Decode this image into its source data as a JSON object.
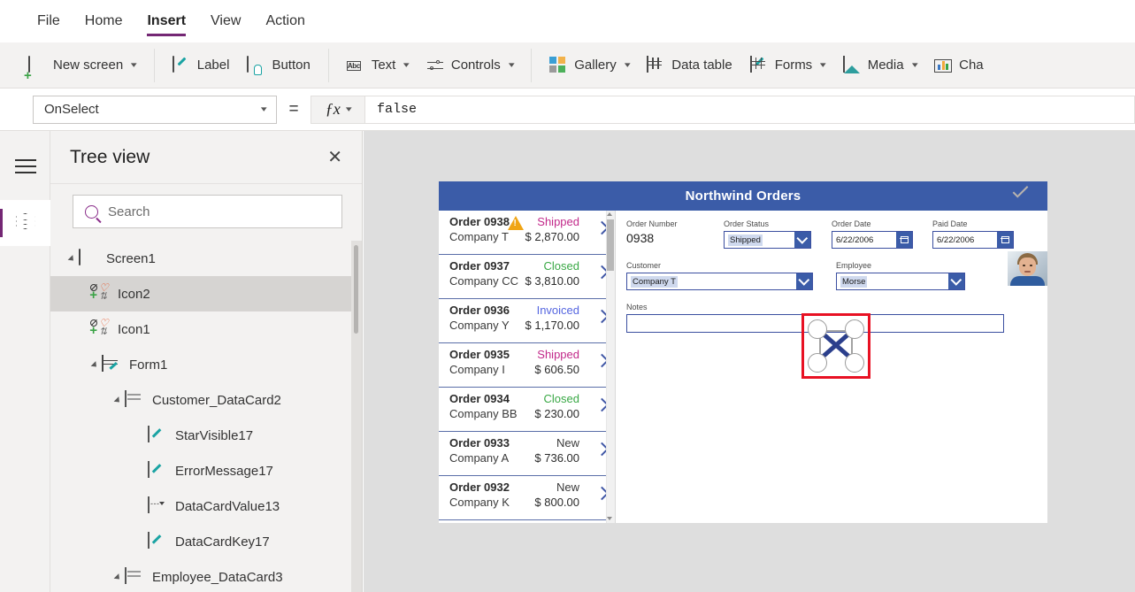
{
  "menubar": {
    "items": [
      {
        "label": "File",
        "active": false
      },
      {
        "label": "Home",
        "active": false
      },
      {
        "label": "Insert",
        "active": true
      },
      {
        "label": "View",
        "active": false
      },
      {
        "label": "Action",
        "active": false
      }
    ]
  },
  "ribbon": {
    "items": [
      {
        "label": "New screen",
        "icon": "new-screen-icon",
        "caret": true
      },
      {
        "label": "Label",
        "icon": "label-icon",
        "caret": false
      },
      {
        "label": "Button",
        "icon": "button-icon",
        "caret": false
      },
      {
        "label": "Text",
        "icon": "text-abc-icon",
        "caret": true
      },
      {
        "label": "Controls",
        "icon": "controls-icon",
        "caret": true
      },
      {
        "label": "Gallery",
        "icon": "gallery-icon",
        "caret": true
      },
      {
        "label": "Data table",
        "icon": "data-table-icon",
        "caret": false
      },
      {
        "label": "Forms",
        "icon": "forms-icon",
        "caret": true
      },
      {
        "label": "Media",
        "icon": "media-icon",
        "caret": true
      },
      {
        "label": "Cha",
        "icon": "charts-icon",
        "caret": false
      }
    ]
  },
  "formula_bar": {
    "property": "OnSelect",
    "equals": "=",
    "fx_label": "ƒx",
    "value": "false"
  },
  "tree_view": {
    "title": "Tree view",
    "close_label": "✕",
    "search_placeholder": "Search",
    "search_value": "",
    "nodes": [
      {
        "label": "Screen1",
        "indent": 0,
        "icon": "screen-icon",
        "expanded": true,
        "selected": false
      },
      {
        "label": "Icon2",
        "indent": 1,
        "icon": "icons-group-icon",
        "expanded": null,
        "selected": true
      },
      {
        "label": "Icon1",
        "indent": 1,
        "icon": "icons-group-icon",
        "expanded": null,
        "selected": false
      },
      {
        "label": "Form1",
        "indent": 1,
        "icon": "form-icon",
        "expanded": true,
        "selected": false
      },
      {
        "label": "Customer_DataCard2",
        "indent": 2,
        "icon": "datacard-icon",
        "expanded": true,
        "selected": false
      },
      {
        "label": "StarVisible17",
        "indent": 3,
        "icon": "label-pencil-icon",
        "expanded": null,
        "selected": false
      },
      {
        "label": "ErrorMessage17",
        "indent": 3,
        "icon": "label-pencil-icon",
        "expanded": null,
        "selected": false
      },
      {
        "label": "DataCardValue13",
        "indent": 3,
        "icon": "dropdown-value-icon",
        "expanded": null,
        "selected": false
      },
      {
        "label": "DataCardKey17",
        "indent": 3,
        "icon": "label-pencil-icon",
        "expanded": null,
        "selected": false
      },
      {
        "label": "Employee_DataCard3",
        "indent": 2,
        "icon": "datacard-icon",
        "expanded": true,
        "selected": false
      }
    ]
  },
  "canvas": {
    "app": {
      "header_title": "Northwind Orders",
      "header_color": "#3b5ca8",
      "confirm_icon": "checkmark-icon",
      "gallery": [
        {
          "order": "Order 0938",
          "company": "Company T",
          "status": "Shipped",
          "status_color": "#c2298a",
          "amount": "$ 2,870.00",
          "warning": true
        },
        {
          "order": "Order 0937",
          "company": "Company CC",
          "status": "Closed",
          "status_color": "#39a845",
          "amount": "$ 3,810.00",
          "warning": false
        },
        {
          "order": "Order 0936",
          "company": "Company Y",
          "status": "Invoiced",
          "status_color": "#5566e0",
          "amount": "$ 1,170.00",
          "warning": false
        },
        {
          "order": "Order 0935",
          "company": "Company I",
          "status": "Shipped",
          "status_color": "#c2298a",
          "amount": "$ 606.50",
          "warning": false
        },
        {
          "order": "Order 0934",
          "company": "Company BB",
          "status": "Closed",
          "status_color": "#39a845",
          "amount": "$ 230.00",
          "warning": false
        },
        {
          "order": "Order 0933",
          "company": "Company A",
          "status": "New",
          "status_color": "#3a3a3a",
          "amount": "$ 736.00",
          "warning": false
        },
        {
          "order": "Order 0932",
          "company": "Company K",
          "status": "New",
          "status_color": "#3a3a3a",
          "amount": "$ 800.00",
          "warning": false
        }
      ],
      "form": {
        "order_number": {
          "label": "Order Number",
          "value": "0938"
        },
        "order_status": {
          "label": "Order Status",
          "value": "Shipped"
        },
        "order_date": {
          "label": "Order Date",
          "value": "6/22/2006"
        },
        "paid_date": {
          "label": "Paid Date",
          "value": "6/22/2006"
        },
        "customer": {
          "label": "Customer",
          "value": "Company T"
        },
        "employee": {
          "label": "Employee",
          "value": "Morse"
        },
        "notes": {
          "label": "Notes",
          "value": ""
        },
        "employee_photo_alt": "employee-photo"
      }
    },
    "selection": {
      "color": "#e81123",
      "control": "Icon2"
    }
  }
}
